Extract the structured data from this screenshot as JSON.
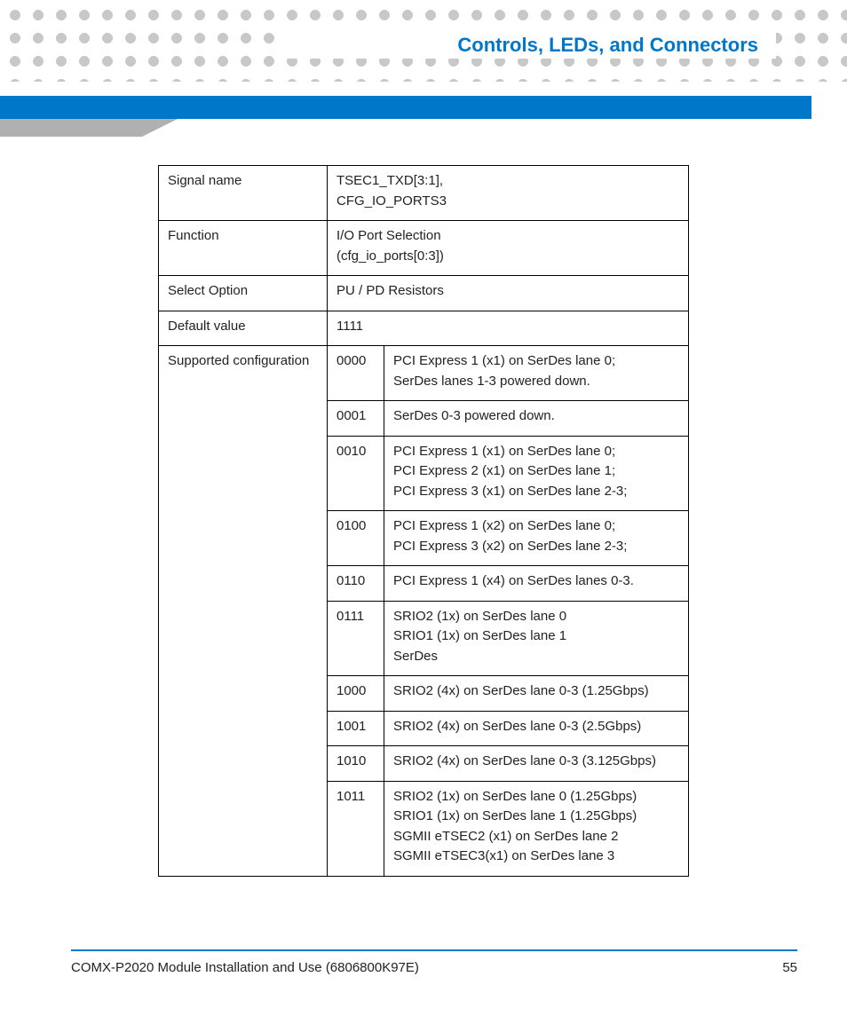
{
  "header": {
    "section": "Controls, LEDs, and Connectors"
  },
  "table": {
    "rows": {
      "signal_name_label": "Signal name",
      "signal_name_value": "TSEC1_TXD[3:1], CFG_IO_PORTS3",
      "function_label": "Function",
      "function_value": "I/O Port Selection (cfg_io_ports[0:3])",
      "select_option_label": "Select Option",
      "select_option_value": "PU / PD Resistors",
      "default_value_label": "Default value",
      "default_value_value": "1111",
      "supported_label": "Supported configuration"
    },
    "configs": [
      {
        "code": "0000",
        "desc": "PCI Express 1 (x1) on SerDes lane 0; SerDes lanes 1-3 powered down."
      },
      {
        "code": "0001",
        "desc": "SerDes 0-3 powered down."
      },
      {
        "code": "0010",
        "desc": "PCI Express 1 (x1) on SerDes lane 0; PCI Express 2 (x1) on SerDes lane 1; PCI Express 3 (x1) on SerDes lane 2-3;"
      },
      {
        "code": "0100",
        "desc": "PCI Express 1 (x2) on SerDes lane 0; PCI Express 3 (x2) on SerDes lane 2-3;"
      },
      {
        "code": "0110",
        "desc": "PCI Express 1 (x4) on SerDes lanes 0-3."
      },
      {
        "code": "0111",
        "desc": "SRIO2 (1x) on SerDes lane 0\nSRIO1 (1x) on SerDes lane 1\nSerDes"
      },
      {
        "code": "1000",
        "desc": "SRIO2 (4x) on SerDes lane 0-3 (1.25Gbps)"
      },
      {
        "code": "1001",
        "desc": "SRIO2 (4x) on SerDes lane 0-3 (2.5Gbps)"
      },
      {
        "code": "1010",
        "desc": "SRIO2 (4x) on SerDes lane 0-3 (3.125Gbps)"
      },
      {
        "code": "1011",
        "desc": "SRIO2 (1x) on SerDes lane 0 (1.25Gbps)\nSRIO1 (1x) on SerDes lane 1 (1.25Gbps)\nSGMII eTSEC2 (x1) on SerDes lane 2\nSGMII eTSEC3(x1) on SerDes lane 3"
      }
    ]
  },
  "footer": {
    "doc": "COMX-P2020 Module Installation and Use (6806800K97E)",
    "page": "55"
  }
}
